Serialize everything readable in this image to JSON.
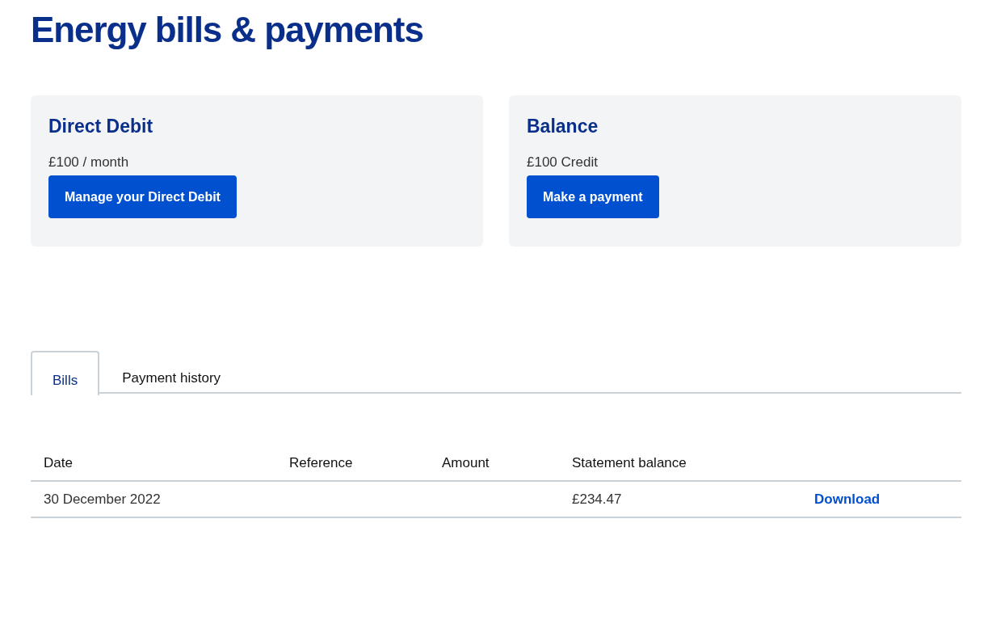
{
  "title": "Energy bills & payments",
  "cards": [
    {
      "title": "Direct Debit",
      "value": "£100 / month",
      "button": "Manage your Direct Debit"
    },
    {
      "title": "Balance",
      "value": "£100 Credit",
      "button": "Make a payment"
    }
  ],
  "tabs": [
    {
      "label": "Bills",
      "selected": true
    },
    {
      "label": "Payment history",
      "selected": false
    }
  ],
  "table": {
    "columns": [
      "Date",
      "Reference",
      "Amount",
      "Statement balance"
    ],
    "rows": [
      {
        "date": "30 December 2022",
        "reference": "",
        "amount": "",
        "statement_balance": "£234.47",
        "action": "Download"
      }
    ]
  }
}
